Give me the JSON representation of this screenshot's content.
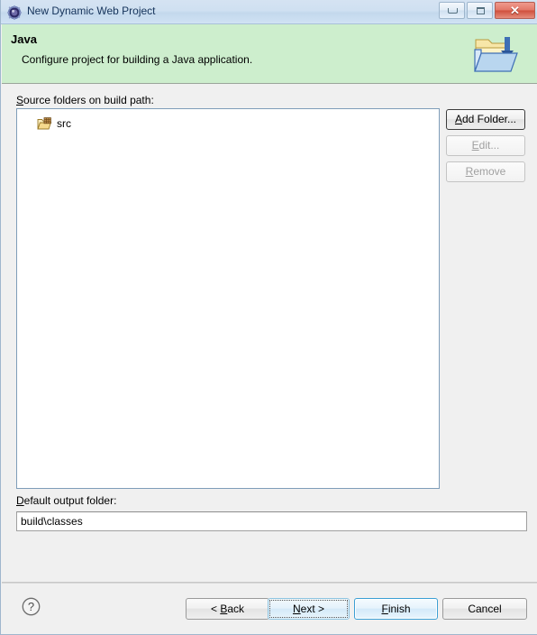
{
  "window": {
    "title": "New Dynamic Web Project",
    "app_icon": "eclipse-wizard-icon",
    "controls": {
      "minimize": "–",
      "maximize": "□",
      "close": "✕"
    }
  },
  "header": {
    "title": "Java",
    "description": "Configure project for building a Java application.",
    "icon": "java-project-folder-icon"
  },
  "main": {
    "source_folders_label": {
      "mnemonic": "S",
      "rest": "ource folders on build path:"
    },
    "tree": {
      "items": [
        {
          "label": "src",
          "icon": "source-folder-icon"
        }
      ]
    },
    "side_buttons": [
      {
        "name": "add-folder",
        "mnemonic": "A",
        "before": "",
        "rest": "dd Folder...",
        "enabled": true,
        "focused": true
      },
      {
        "name": "edit",
        "mnemonic": "E",
        "before": "",
        "rest": "dit...",
        "enabled": false,
        "focused": false
      },
      {
        "name": "remove",
        "mnemonic": "R",
        "before": "",
        "rest": "emove",
        "enabled": false,
        "focused": false
      }
    ],
    "output_folder_label": {
      "mnemonic": "D",
      "rest": "efault output folder:"
    },
    "output_folder_value": "build\\classes",
    "output_folder_placeholder": ""
  },
  "footer": {
    "help_icon": "help-question-icon",
    "buttons": [
      {
        "name": "back",
        "before": "< ",
        "mnemonic": "B",
        "rest": "ack",
        "style": "normal"
      },
      {
        "name": "next",
        "before": "",
        "mnemonic": "N",
        "rest": "ext >",
        "style": "focused"
      },
      {
        "name": "finish",
        "before": "",
        "mnemonic": "F",
        "rest": "inish",
        "style": "default"
      },
      {
        "name": "cancel",
        "before": "",
        "mnemonic": "",
        "rest": "Cancel",
        "style": "normal"
      }
    ]
  },
  "colors": {
    "header_bg": "#cdeecd",
    "titlebar_bg": "#cfe0f1",
    "dialog_bg": "#f0f0f0",
    "default_button_border": "#3c9fd4",
    "close_button": "#cf4f3c"
  }
}
